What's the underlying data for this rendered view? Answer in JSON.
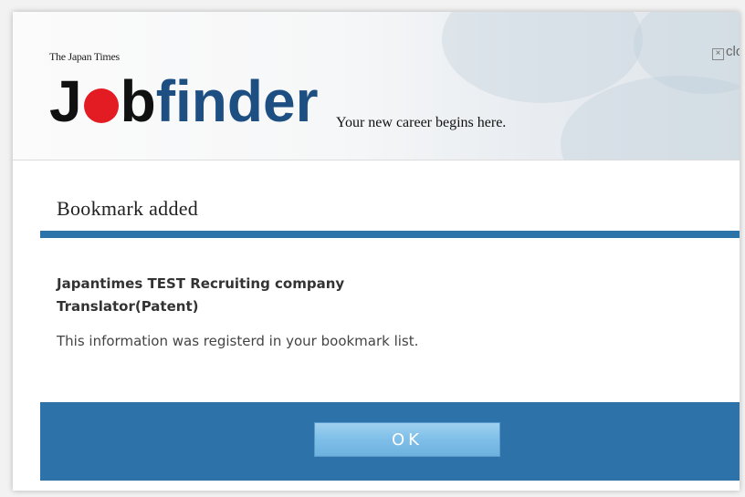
{
  "header": {
    "publisher": "The Japan Times",
    "logo": {
      "part1": "J",
      "part2": "b",
      "part3": "finder"
    },
    "tagline": "Your new career begins here.",
    "close_label": "clo",
    "close_box": "×"
  },
  "dialog": {
    "title": "Bookmark added",
    "company": "Japantimes TEST Recruiting company",
    "position": "Translator(Patent)",
    "message": "This information was registerd in your bookmark list.",
    "ok_label": "OK"
  },
  "colors": {
    "accent_blue": "#2d73a9",
    "logo_red": "#e31b23",
    "logo_blue": "#1e4f82",
    "button_blue": "#8ec8ec"
  }
}
